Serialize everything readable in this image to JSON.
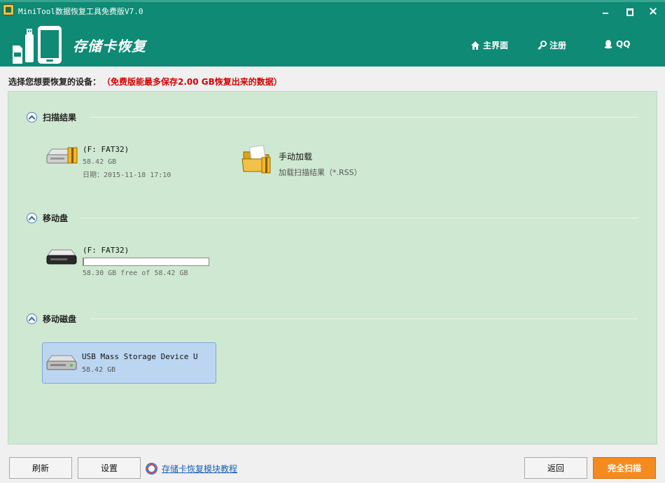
{
  "window": {
    "title": "MiniTool数据恢复工具免费版V7.0"
  },
  "header": {
    "app_name": "存储卡恢复",
    "nav": {
      "home": "主界面",
      "register": "注册",
      "qq": "QQ"
    }
  },
  "instruction": {
    "text": "选择您想要恢复的设备：",
    "note": "（免费版能最多保存2.00 GB恢复出来的数据）"
  },
  "sections": {
    "scan_results": {
      "label": "扫描结果",
      "drive": {
        "name": "(F: FAT32)",
        "size": "58.42 GB",
        "date": "日期：2015-11-18 17:10"
      },
      "manual_load": {
        "title": "手动加载",
        "subtitle": "加载扫描结果（*.RSS）"
      }
    },
    "removable": {
      "label": "移动盘",
      "drive": {
        "name": "(F: FAT32)",
        "usage_fraction": 0.003,
        "free_text": "58.30 GB free of 58.42 GB"
      }
    },
    "removable_disk": {
      "label": "移动磁盘",
      "device": {
        "name": "USB Mass Storage Device U",
        "size": "58.42 GB"
      }
    }
  },
  "bottom": {
    "refresh": "刷新",
    "settings": "设置",
    "tutorial": "存储卡恢复模块教程",
    "back": "返回",
    "scan": "完全扫描"
  },
  "colors": {
    "brand": "#0e8a75",
    "panel": "#cfe8d1",
    "note": "#d40000",
    "scan_button": "#f58a1f",
    "selected_card": "#bcd6f2"
  }
}
